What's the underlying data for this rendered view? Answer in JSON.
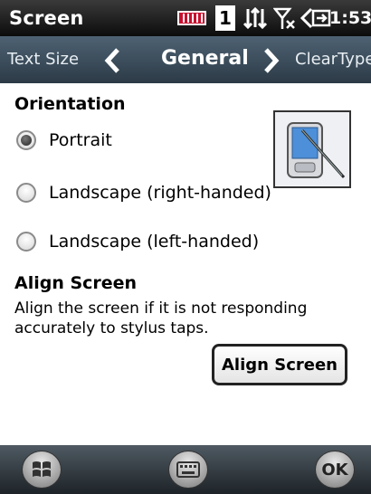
{
  "status_bar": {
    "title": "Screen",
    "sim_number": "1",
    "time": "1:53",
    "icons": [
      "battery-icon",
      "sim-card-icon",
      "data-connection-icon",
      "no-signal-icon",
      "volume-icon",
      "sync-icon"
    ]
  },
  "tabs": {
    "previous": "Text Size",
    "current": "General",
    "next": "ClearType"
  },
  "orientation": {
    "title": "Orientation",
    "options": [
      {
        "label": "Portrait",
        "selected": true
      },
      {
        "label": "Landscape (right-handed)",
        "selected": false
      },
      {
        "label": "Landscape (left-handed)",
        "selected": false
      }
    ],
    "preview_icon": "device-stylus-icon"
  },
  "align": {
    "title": "Align Screen",
    "description": "Align the screen if it is not responding accurately to stylus taps.",
    "button_label": "Align Screen"
  },
  "softkeys": {
    "left": "windows-start-icon",
    "center": "keyboard-icon",
    "right_label": "OK"
  }
}
